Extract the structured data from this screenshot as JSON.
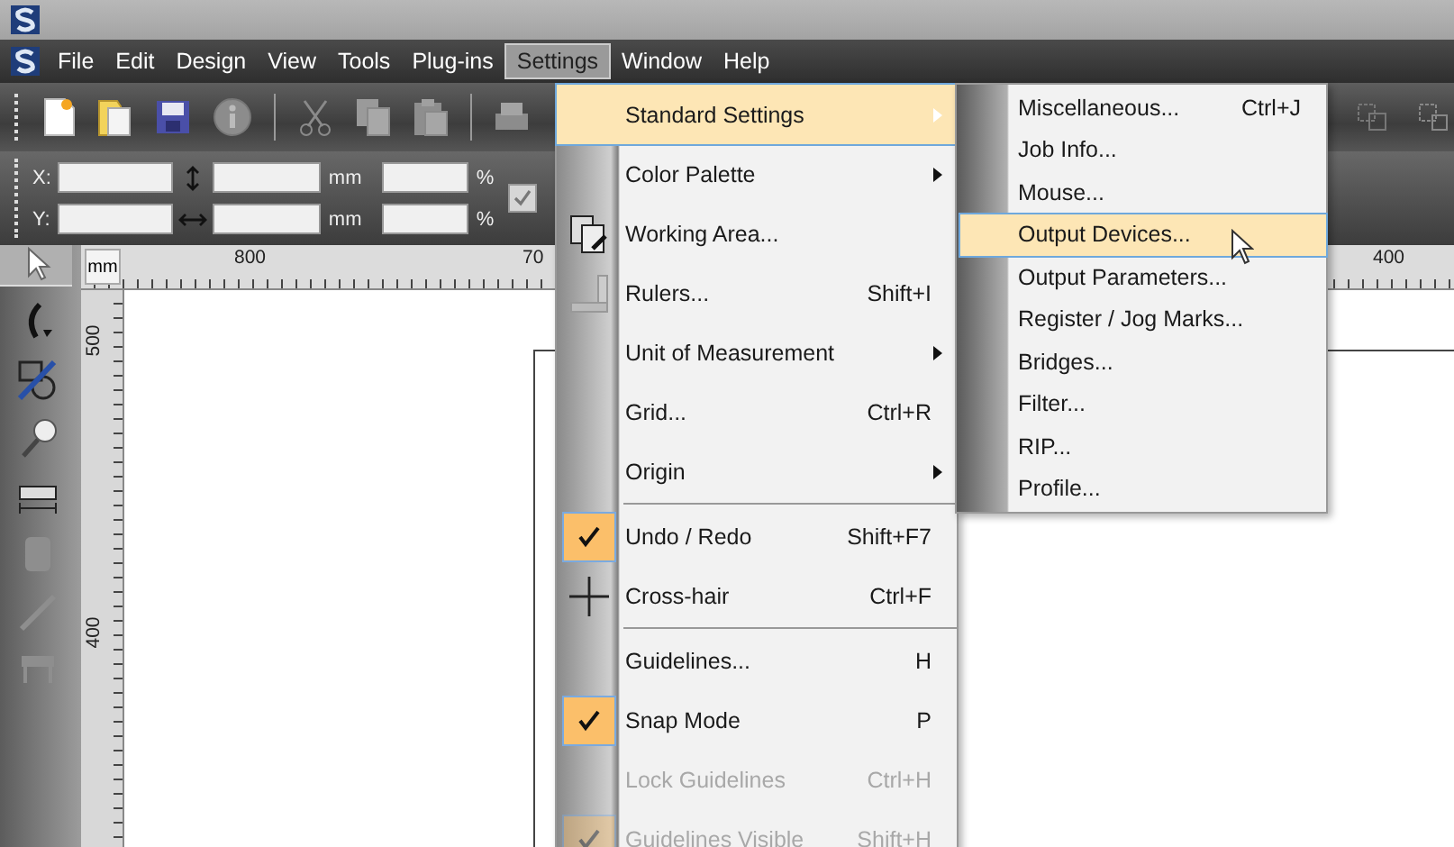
{
  "menubar": [
    {
      "label": "File",
      "selected": false
    },
    {
      "label": "Edit",
      "selected": false
    },
    {
      "label": "Design",
      "selected": false
    },
    {
      "label": "View",
      "selected": false
    },
    {
      "label": "Tools",
      "selected": false
    },
    {
      "label": "Plug-ins",
      "selected": false
    },
    {
      "label": "Settings",
      "selected": true
    },
    {
      "label": "Window",
      "selected": false
    },
    {
      "label": "Help",
      "selected": false
    }
  ],
  "coordinates": {
    "x_label": "X:",
    "y_label": "Y:",
    "units": [
      "mm",
      "mm"
    ],
    "percents": [
      "%",
      "%"
    ],
    "proportional_checked": true
  },
  "ruler": {
    "unit": "mm",
    "top_labels": [
      "800",
      "70",
      "400"
    ],
    "left_labels": [
      "500",
      "400"
    ]
  },
  "settings_menu": [
    {
      "kind": "submenu",
      "label": "Standard Settings",
      "selected": true,
      "checked": false,
      "disabled": false
    },
    {
      "kind": "submenu",
      "label": "Color Palette",
      "selected": false,
      "checked": false,
      "disabled": false
    },
    {
      "kind": "command",
      "label": "Working Area...",
      "selected": false,
      "checked": false,
      "disabled": false
    },
    {
      "kind": "command",
      "label": "Rulers...",
      "shortcut": "Shift+I",
      "selected": false,
      "checked": false,
      "disabled": false
    },
    {
      "kind": "submenu",
      "label": "Unit of Measurement",
      "selected": false,
      "checked": false,
      "disabled": false
    },
    {
      "kind": "command",
      "label": "Grid...",
      "shortcut": "Ctrl+R",
      "selected": false,
      "checked": false,
      "disabled": false
    },
    {
      "kind": "submenu",
      "label": "Origin",
      "selected": false,
      "checked": false,
      "disabled": false
    },
    {
      "kind": "separator"
    },
    {
      "kind": "command",
      "label": "Undo / Redo",
      "shortcut": "Shift+F7",
      "selected": false,
      "checked": true,
      "disabled": false
    },
    {
      "kind": "command",
      "label": "Cross-hair",
      "shortcut": "Ctrl+F",
      "selected": false,
      "checked": false,
      "disabled": false
    },
    {
      "kind": "separator"
    },
    {
      "kind": "command",
      "label": "Guidelines...",
      "shortcut": "H",
      "selected": false,
      "checked": false,
      "disabled": false
    },
    {
      "kind": "command",
      "label": "Snap Mode",
      "shortcut": "P",
      "selected": false,
      "checked": true,
      "disabled": false
    },
    {
      "kind": "command",
      "label": "Lock Guidelines",
      "shortcut": "Ctrl+H",
      "selected": false,
      "checked": false,
      "disabled": true
    },
    {
      "kind": "command",
      "label": "Guidelines Visible",
      "shortcut": "Shift+H",
      "selected": false,
      "checked": true,
      "disabled": true
    }
  ],
  "standard_settings_submenu": [
    {
      "label": "Miscellaneous...",
      "shortcut": "Ctrl+J",
      "selected": false
    },
    {
      "label": "Job Info...",
      "selected": false
    },
    {
      "label": "Mouse...",
      "selected": false
    },
    {
      "label": "Output Devices...",
      "selected": true
    },
    {
      "label": "Output Parameters...",
      "selected": false
    },
    {
      "label": "Register / Jog Marks...",
      "selected": false
    },
    {
      "label": "Bridges...",
      "selected": false
    },
    {
      "label": "Filter...",
      "selected": false
    },
    {
      "label": "RIP...",
      "selected": false
    },
    {
      "label": "Profile...",
      "selected": false
    }
  ]
}
